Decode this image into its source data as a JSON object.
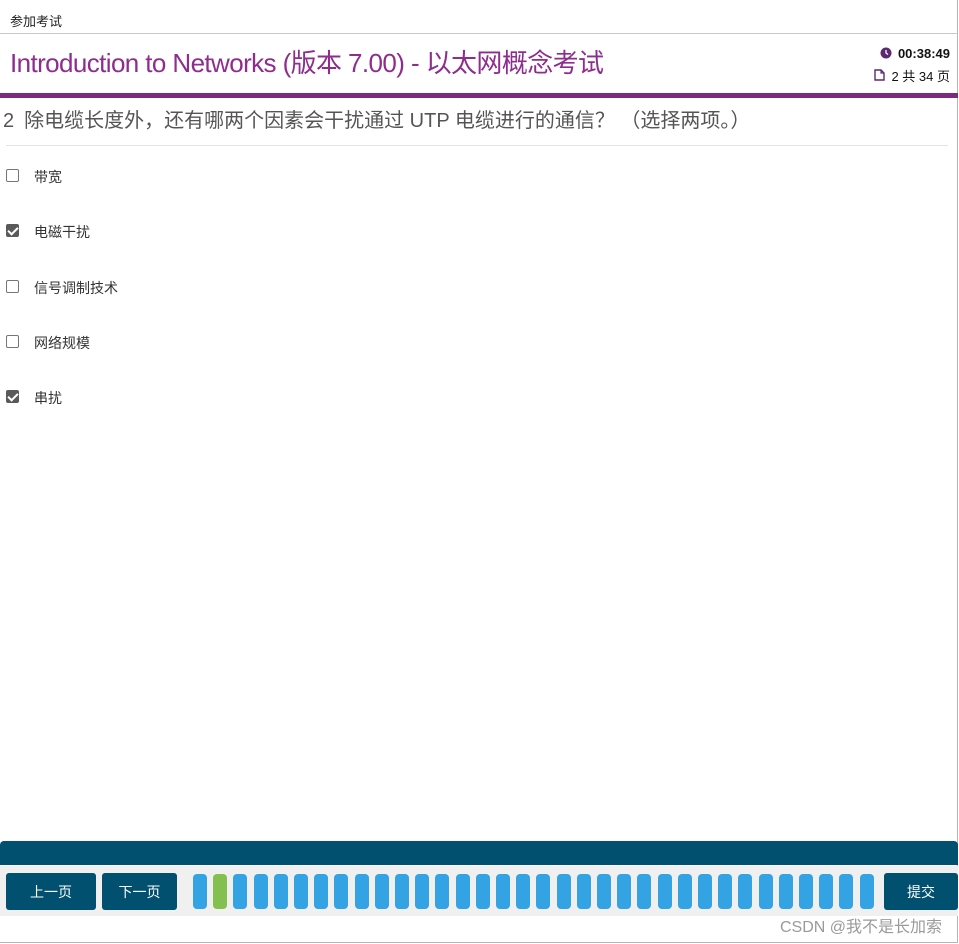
{
  "topbar": {
    "label": "参加考试"
  },
  "header": {
    "title_prefix": "Introduction to Networks (版本 7.00) - ",
    "title_suffix": "以太网概念考试",
    "timer": "00:38:49",
    "page_info": "2 共 34 页"
  },
  "question": {
    "number": "2",
    "text": "除电缆长度外，还有哪两个因素会干扰通过 UTP 电缆进行的通信？ （选择两项。）"
  },
  "options": [
    {
      "label": "带宽",
      "checked": false
    },
    {
      "label": "电磁干扰",
      "checked": true
    },
    {
      "label": "信号调制技术",
      "checked": false
    },
    {
      "label": "网络规模",
      "checked": false
    },
    {
      "label": "串扰",
      "checked": true
    }
  ],
  "nav": {
    "prev_label": "上一页",
    "next_label": "下一页",
    "submit_label": "提交",
    "page_count": 34,
    "current_page": 2
  },
  "watermark": "CSDN @我不是长加索",
  "colors": {
    "title": "#8e2d8e",
    "accent_bar": "#7c2a7e",
    "nav_button": "#02506f",
    "page_indicator": "#33a3e3",
    "page_current": "#83c050"
  }
}
